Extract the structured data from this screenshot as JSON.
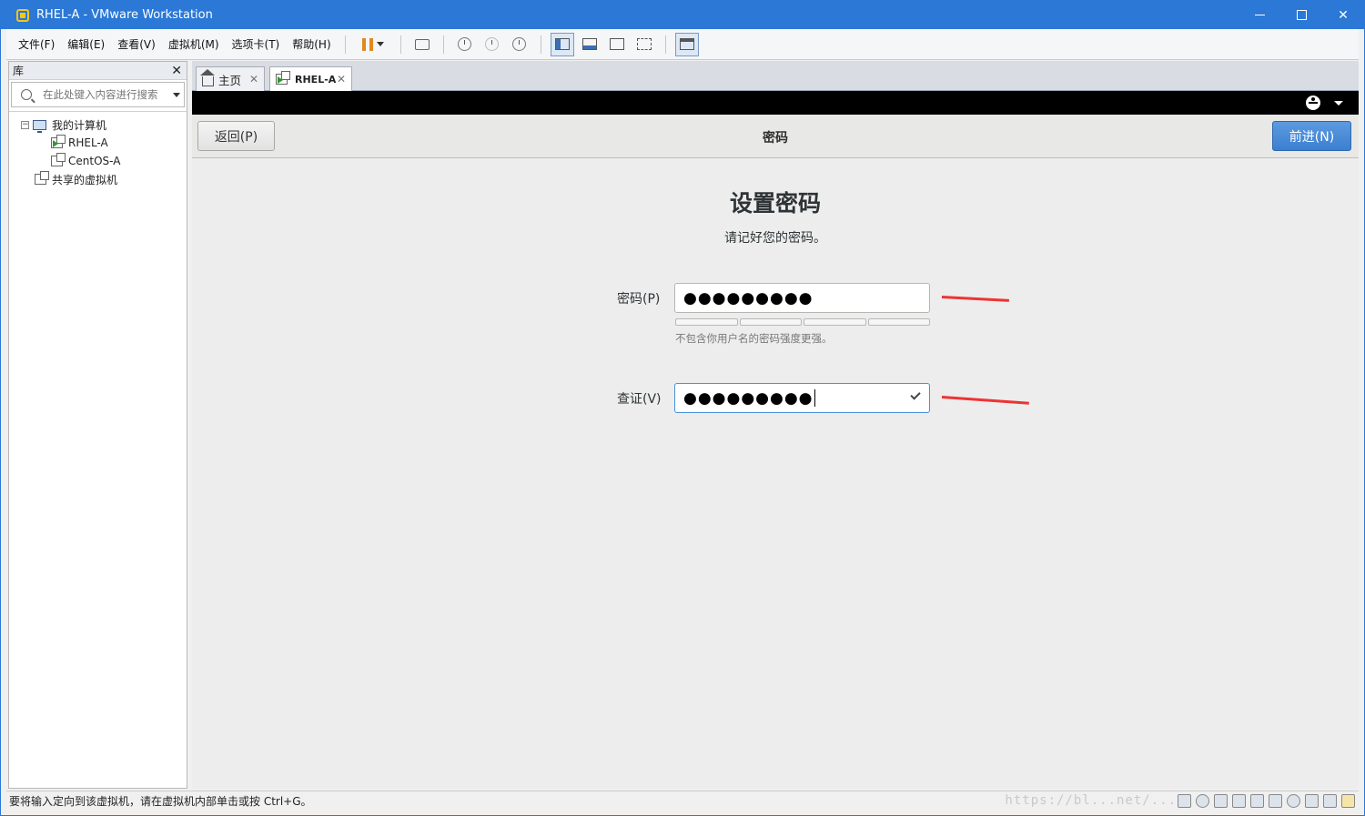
{
  "window": {
    "title": "RHEL-A - VMware Workstation"
  },
  "menubar": {
    "items": [
      "文件(F)",
      "编辑(E)",
      "查看(V)",
      "虚拟机(M)",
      "选项卡(T)",
      "帮助(H)"
    ]
  },
  "library": {
    "title": "库",
    "close": "✕",
    "search_placeholder": "在此处键入内容进行搜索",
    "tree": {
      "root": "我的计算机",
      "vms": [
        "RHEL-A",
        "CentOS-A"
      ],
      "shared": "共享的虚拟机"
    }
  },
  "tabs": {
    "home": "主页",
    "vm": "RHEL-A",
    "close": "✕"
  },
  "installer": {
    "back_button": "返回(P)",
    "header_title": "密码",
    "next_button": "前进(N)",
    "heading": "设置密码",
    "subheading": "请记好您的密码。",
    "password_label": "密码(P)",
    "password_value": "●●●●●●●●●",
    "strength_hint": "不包含你用户名的密码强度更强。",
    "confirm_label": "查证(V)",
    "confirm_value": "●●●●●●●●●"
  },
  "statusbar": {
    "message": "要将输入定向到该虚拟机，请在虚拟机内部单击或按 Ctrl+G。",
    "watermark": "https://bl...net/..."
  },
  "colors": {
    "accent": "#2b78d6",
    "next_button": "#3b7fcf",
    "annotation_arrow": "#ee3333"
  }
}
